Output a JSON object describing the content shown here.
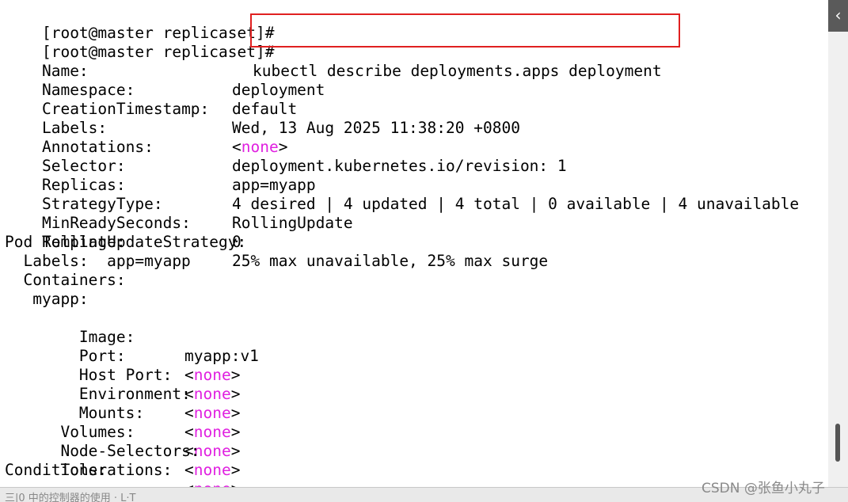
{
  "terminal": {
    "prompt": "[root@master replicaset]#",
    "command": "kubectl describe deployments.apps deployment",
    "fields": [
      {
        "key": "Name:",
        "value": "deployment"
      },
      {
        "key": "Namespace:",
        "value": "default"
      },
      {
        "key": "CreationTimestamp:",
        "value": "Wed, 13 Aug 2025 11:38:20 +0800"
      },
      {
        "key": "Labels:",
        "none": "none"
      },
      {
        "key": "Annotations:",
        "value": "deployment.kubernetes.io/revision: 1"
      },
      {
        "key": "Selector:",
        "value": "app=myapp"
      },
      {
        "key": "Replicas:",
        "value": "4 desired | 4 updated | 4 total | 0 available | 4 unavailable"
      },
      {
        "key": "StrategyType:",
        "value": "RollingUpdate"
      },
      {
        "key": "MinReadySeconds:",
        "value": "0"
      },
      {
        "key": "RollingUpdateStrategy:",
        "value": "25% max unavailable, 25% max surge"
      }
    ],
    "pod_template": {
      "header": "Pod Template:",
      "labels_line": "  Labels:  app=myapp",
      "containers_header": "  Containers:",
      "container_name": "   myapp:",
      "container_fields": [
        {
          "key": "    Image:",
          "value": "myapp:v1"
        },
        {
          "key": "    Port:",
          "none": "none"
        },
        {
          "key": "    Host Port:",
          "none": "none"
        },
        {
          "key": "    Environment:",
          "none": "none"
        },
        {
          "key": "    Mounts:",
          "none": "none"
        }
      ],
      "spec_fields": [
        {
          "key": "  Volumes:",
          "none": "none"
        },
        {
          "key": "  Node-Selectors:",
          "none": "none"
        },
        {
          "key": "  Tolerations:",
          "none": "none"
        }
      ]
    },
    "conditions": "Conditions:"
  },
  "sidebar": {
    "collapse_glyph": "‹"
  },
  "bottom_bar": {
    "text": "三|0 中的控制器的使用 · L·T"
  },
  "watermark": "CSDN @张鱼小丸子",
  "colors": {
    "none_keyword": "#e020e0",
    "highlight": "#e02020"
  }
}
